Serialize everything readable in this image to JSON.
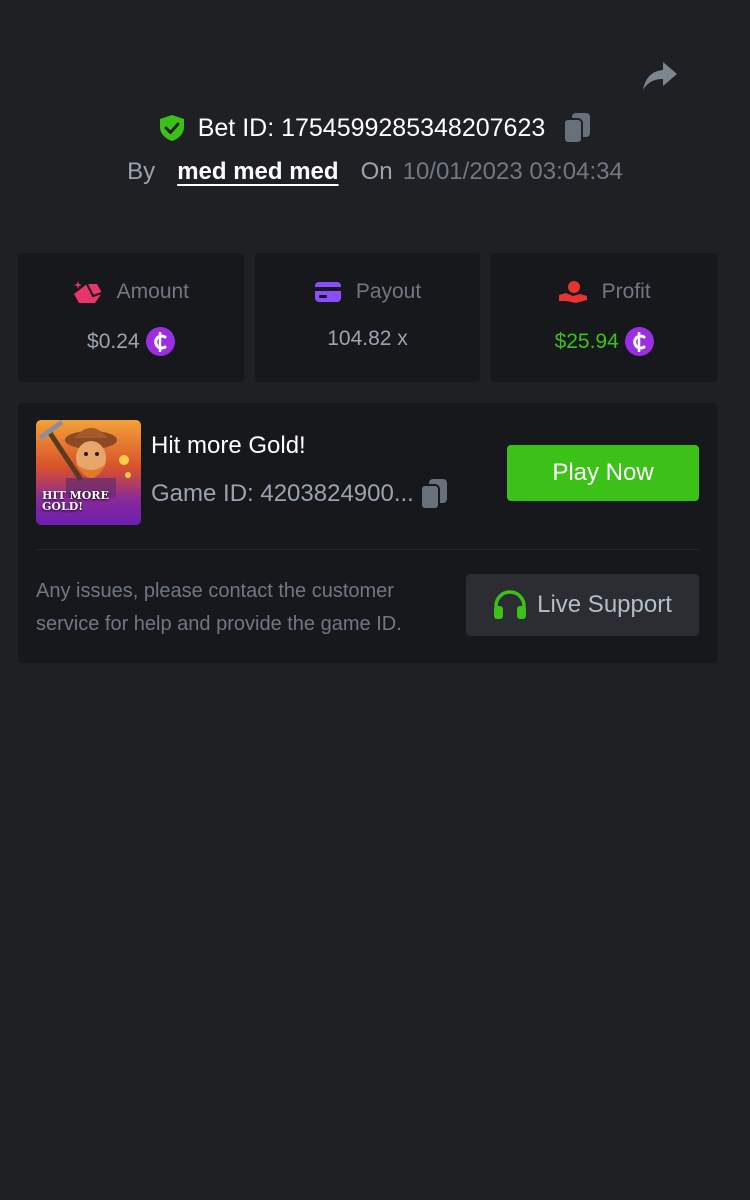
{
  "header": {
    "bet_id": "Bet ID: 1754599285348207623",
    "by_label": "By",
    "username": "med med med",
    "on_label": "On",
    "datetime": "10/01/2023 03:04:34"
  },
  "stats": {
    "amount": {
      "label": "Amount",
      "value": "$0.24"
    },
    "payout": {
      "label": "Payout",
      "value": "104.82 x"
    },
    "profit": {
      "label": "Profit",
      "value": "$25.94"
    }
  },
  "game": {
    "title": "Hit more Gold!",
    "game_id": "Game ID: 4203824900...",
    "thumbnail_text": "HIT MORE GOLD!",
    "play_label": "Play Now"
  },
  "support": {
    "message": "Any issues, please contact the customer service for help and provide the game ID.",
    "button_label": "Live Support"
  },
  "colors": {
    "background": "#1f2024",
    "card": "#17181b",
    "accent_green": "#3bc117",
    "coin_purple": "#9a2ee0",
    "amount_icon": "#e8366a",
    "payout_icon": "#8a4dff",
    "profit_icon": "#e8332f"
  },
  "icons": {
    "share": "share-arrow-icon",
    "verified": "shield-check-icon",
    "copy": "copy-icon",
    "coin": "coin-icon",
    "support": "headphones-icon"
  }
}
